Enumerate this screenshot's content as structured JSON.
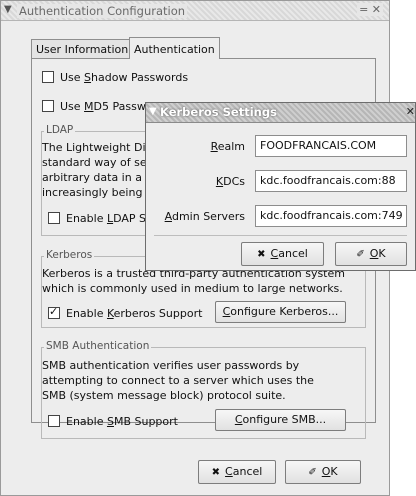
{
  "window": {
    "title": "Authentication Configuration",
    "controls": "= ✕"
  },
  "tabs": [
    {
      "label": "User Information",
      "active": false
    },
    {
      "label": "Authentication",
      "active": true
    }
  ],
  "auth": {
    "shadow": {
      "pre": "Use ",
      "u": "S",
      "post": "hadow Passwords",
      "checked": false
    },
    "md5": {
      "pre": "Use ",
      "u": "M",
      "post": "D5 Passwords",
      "checked": false
    }
  },
  "ldap": {
    "label": "LDAP",
    "lines": [
      "The Lightweight Directory Access Protocol is a",
      "standard way of searching a directory, which can hold",
      "arbitrary data in a structured hierarchy. LDAP is",
      "increasingly being used in small to large networks."
    ],
    "enable": {
      "pre": "Enable ",
      "u": "L",
      "post": "DAP Support",
      "checked": false
    }
  },
  "kerberos": {
    "label": "Kerberos",
    "lines": [
      "Kerberos is a trusted third-party authentication system",
      "which is commonly used in medium to large networks."
    ],
    "enable": {
      "pre": "Enable ",
      "u": "K",
      "post": "erberos Support",
      "checked": true
    },
    "configure": {
      "u": "C",
      "post": "onfigure Kerberos..."
    }
  },
  "smb": {
    "label": "SMB Authentication",
    "lines": [
      "SMB authentication verifies user passwords by",
      "attempting to connect to a server which uses the",
      "SMB (system message block) protocol suite."
    ],
    "enable": {
      "pre": "Enable ",
      "u": "S",
      "post": "MB Support",
      "checked": false
    },
    "configure": {
      "u": "C",
      "post": "onfigure SMB..."
    }
  },
  "footer": {
    "cancel": {
      "u": "C",
      "post": "ancel"
    },
    "ok": {
      "u": "O",
      "post": "K"
    }
  },
  "dialog": {
    "title": "Kerberos Settings",
    "close": "✕",
    "realm": {
      "u": "R",
      "post": "ealm",
      "value": "FOODFRANCAIS.COM"
    },
    "kdcs": {
      "u": "K",
      "post": "DCs",
      "value": "kdc.foodfrancais.com:88"
    },
    "admin": {
      "u": "A",
      "post": "dmin Servers",
      "value": "kdc.foodfrancais.com:749"
    },
    "cancel": {
      "u": "C",
      "post": "ancel"
    },
    "ok": {
      "u": "O",
      "post": "K"
    }
  }
}
